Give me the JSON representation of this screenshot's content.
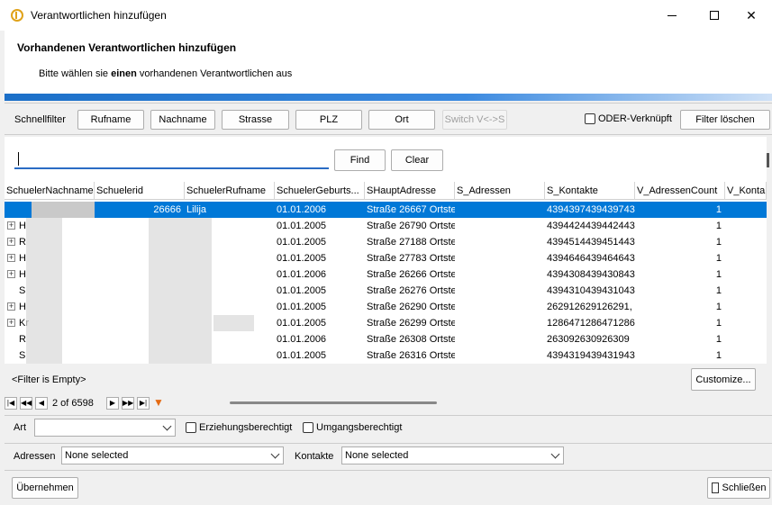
{
  "window": {
    "title": "Verantwortlichen hinzufügen"
  },
  "header": {
    "title": "Vorhandenen Verantwortlichen hinzufügen",
    "subtitle_pre": "Bitte wählen sie ",
    "subtitle_bold": "einen",
    "subtitle_post": " vorhandenen Verantwortlichen aus"
  },
  "quickfilter": {
    "label": "Schnellfilter",
    "buttons": [
      "Rufname",
      "Nachname",
      "Strasse",
      "PLZ",
      "Ort"
    ],
    "switch_label": "Switch V<->S",
    "oder_label": "ODER-Verknüpft",
    "clear_label": "Filter löschen"
  },
  "search": {
    "value": "",
    "find_label": "Find",
    "clear_label": "Clear"
  },
  "grid": {
    "columns": [
      "SchuelerNachname",
      "Schuelerid",
      "SchuelerRufname",
      "SchuelerGeburts...",
      "SHauptAdresse",
      "S_Adressen",
      "S_Kontakte",
      "V_AdressenCount",
      "V_Konta"
    ],
    "rows": [
      {
        "nachname": "",
        "id": "26666",
        "rufname": "Lilija",
        "geburt": "01.01.2006",
        "adresse": "Straße 26667 Ortste",
        "kontakte": "4394397439439743",
        "count": "1",
        "expand": false,
        "selected": true
      },
      {
        "nachname": "H",
        "id": "",
        "rufname": "",
        "geburt": "01.01.2005",
        "adresse": "Straße 26790 Ortste",
        "kontakte": "4394424439442443",
        "count": "1",
        "expand": true,
        "selected": false
      },
      {
        "nachname": "R",
        "id": "",
        "rufname": "",
        "geburt": "01.01.2005",
        "adresse": "Straße 27188 Ortste",
        "kontakte": "4394514439451443",
        "count": "1",
        "expand": true,
        "selected": false
      },
      {
        "nachname": "H",
        "id": "",
        "rufname": "",
        "geburt": "01.01.2005",
        "adresse": "Straße 27783 Ortste",
        "kontakte": "4394646439464643",
        "count": "1",
        "expand": true,
        "selected": false
      },
      {
        "nachname": "H",
        "id": "",
        "rufname": "",
        "geburt": "01.01.2006",
        "adresse": "Straße 26266 Ortste",
        "kontakte": "4394308439430843",
        "count": "1",
        "expand": true,
        "selected": false
      },
      {
        "nachname": "S",
        "id": "",
        "rufname": "",
        "geburt": "01.01.2005",
        "adresse": "Straße 26276 Ortste",
        "kontakte": "4394310439431043",
        "count": "1",
        "expand": false,
        "selected": false
      },
      {
        "nachname": "H",
        "id": "",
        "rufname": "",
        "geburt": "01.01.2005",
        "adresse": "Straße 26290 Ortste",
        "kontakte": "262912629126291,",
        "count": "1",
        "expand": true,
        "selected": false
      },
      {
        "nachname": "Kr",
        "id": "",
        "rufname": "",
        "geburt": "01.01.2005",
        "adresse": "Straße 26299 Ortste",
        "kontakte": "1286471286471286",
        "count": "1",
        "expand": true,
        "selected": false
      },
      {
        "nachname": "R",
        "id": "",
        "rufname": "",
        "geburt": "01.01.2006",
        "adresse": "Straße 26308 Ortste",
        "kontakte": "263092630926309",
        "count": "1",
        "expand": false,
        "selected": false
      },
      {
        "nachname": "S",
        "id": "",
        "rufname": "",
        "geburt": "01.01.2005",
        "adresse": "Straße 26316 Ortste",
        "kontakte": "4394319439431943",
        "count": "1",
        "expand": false,
        "selected": false
      }
    ],
    "filter_status": "<Filter is Empty>",
    "customize_label": "Customize..."
  },
  "pager": {
    "position": "2 of 6598"
  },
  "bottom": {
    "art_label": "Art",
    "art_value": "",
    "erziehung_label": "Erziehungsberechtigt",
    "umgang_label": "Umgangsberechtigt",
    "adressen_label": "Adressen",
    "adressen_value": "None selected",
    "kontakte_label": "Kontakte",
    "kontakte_value": "None selected",
    "apply_label": "Übernehmen",
    "close_label": "Schließen"
  }
}
